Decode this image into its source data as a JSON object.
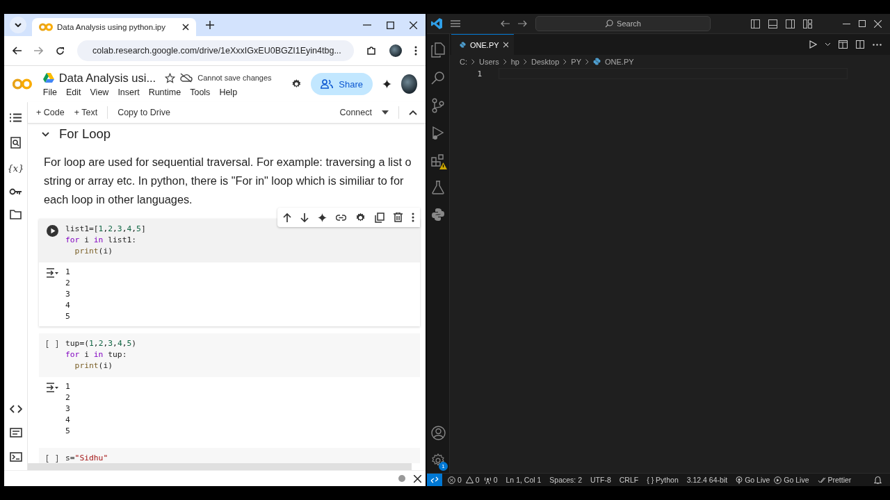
{
  "browser": {
    "tab_title": "Data Analysis using python.ipy",
    "url": "colab.research.google.com/drive/1eXxxIGxEU0BGZI1Eyin4tbg..."
  },
  "colab": {
    "title": "Data Analysis usi...",
    "save_status": "Cannot save changes",
    "share": "Share",
    "menu": [
      "File",
      "Edit",
      "View",
      "Insert",
      "Runtime",
      "Tools",
      "Help"
    ],
    "toolbar": {
      "add_code": "+ Code",
      "add_text": "+ Text",
      "copy": "Copy to Drive",
      "connect": "Connect"
    },
    "sidebar_label": "{x}",
    "section": {
      "title": "For Loop",
      "expanded": true,
      "lines": [
        "For loop are used for sequential traversal. For example: traversing a list o",
        "string or array etc. In python, there is \"For in\" loop which is similiar to for",
        "each loop in other languages."
      ]
    },
    "cells": [
      {
        "kind": "run",
        "toolbar": true,
        "code": [
          {
            "indent": false,
            "tokens": [
              {
                "text": "list1=[",
                "kind": "plain"
              },
              {
                "text": "1",
                "kind": "number"
              },
              {
                "text": ",",
                "kind": "plain"
              },
              {
                "text": "2",
                "kind": "number"
              },
              {
                "text": ",",
                "kind": "plain"
              },
              {
                "text": "3",
                "kind": "number"
              },
              {
                "text": ",",
                "kind": "plain"
              },
              {
                "text": "4",
                "kind": "number"
              },
              {
                "text": ",",
                "kind": "plain"
              },
              {
                "text": "5",
                "kind": "number"
              },
              {
                "text": "]",
                "kind": "plain"
              }
            ]
          },
          {
            "indent": false,
            "tokens": [
              {
                "text": "for",
                "kind": "keyword"
              },
              {
                "text": " i ",
                "kind": "plain"
              },
              {
                "text": "in",
                "kind": "keyword"
              },
              {
                "text": " list1:",
                "kind": "plain"
              }
            ]
          },
          {
            "indent": true,
            "tokens": [
              {
                "text": "print",
                "kind": "function"
              },
              {
                "text": "(i)",
                "kind": "plain"
              }
            ]
          }
        ],
        "output": [
          "1",
          "2",
          "3",
          "4",
          "5"
        ]
      },
      {
        "kind": "idle",
        "prompt": "[ ]",
        "toolbar": false,
        "code": [
          {
            "indent": false,
            "tokens": [
              {
                "text": "tup=(",
                "kind": "plain"
              },
              {
                "text": "1",
                "kind": "number"
              },
              {
                "text": ",",
                "kind": "plain"
              },
              {
                "text": "2",
                "kind": "number"
              },
              {
                "text": ",",
                "kind": "plain"
              },
              {
                "text": "3",
                "kind": "number"
              },
              {
                "text": ",",
                "kind": "plain"
              },
              {
                "text": "4",
                "kind": "number"
              },
              {
                "text": ",",
                "kind": "plain"
              },
              {
                "text": "5",
                "kind": "number"
              },
              {
                "text": ")",
                "kind": "plain"
              }
            ]
          },
          {
            "indent": false,
            "tokens": [
              {
                "text": "for",
                "kind": "keyword"
              },
              {
                "text": " i ",
                "kind": "plain"
              },
              {
                "text": "in",
                "kind": "keyword"
              },
              {
                "text": " tup:",
                "kind": "plain"
              }
            ]
          },
          {
            "indent": true,
            "tokens": [
              {
                "text": "print",
                "kind": "function"
              },
              {
                "text": "(i)",
                "kind": "plain"
              }
            ]
          }
        ],
        "output": [
          "1",
          "2",
          "3",
          "4",
          "5"
        ]
      },
      {
        "kind": "idle",
        "prompt": "[ ]",
        "toolbar": false,
        "code": [
          {
            "indent": false,
            "tokens": [
              {
                "text": "s=",
                "kind": "plain"
              },
              {
                "text": "\"Sidhu\"",
                "kind": "string"
              }
            ]
          }
        ]
      }
    ]
  },
  "vscode": {
    "search": "Search",
    "tab": "ONE.PY",
    "breadcrumb": [
      "C:",
      "Users",
      "hp",
      "Desktop",
      "PY",
      "ONE.PY"
    ],
    "line_number": "1",
    "settings_badge": "1",
    "status": [
      {
        "kind": "errors",
        "text": "0"
      },
      {
        "kind": "warnings",
        "text": "0"
      },
      {
        "kind": "ports",
        "text": "0"
      },
      {
        "kind": "text",
        "text": "Ln 1, Col 1"
      },
      {
        "kind": "text",
        "text": "Spaces: 2"
      },
      {
        "kind": "text",
        "text": "UTF-8"
      },
      {
        "kind": "text",
        "text": "CRLF"
      },
      {
        "kind": "text",
        "text": "{ } Python"
      },
      {
        "kind": "text",
        "text": "3.12.4 64-bit"
      },
      {
        "kind": "golive",
        "text": "Go Live"
      },
      {
        "kind": "golive2",
        "text": "Go Live"
      },
      {
        "kind": "prettier",
        "text": "Prettier"
      }
    ]
  }
}
